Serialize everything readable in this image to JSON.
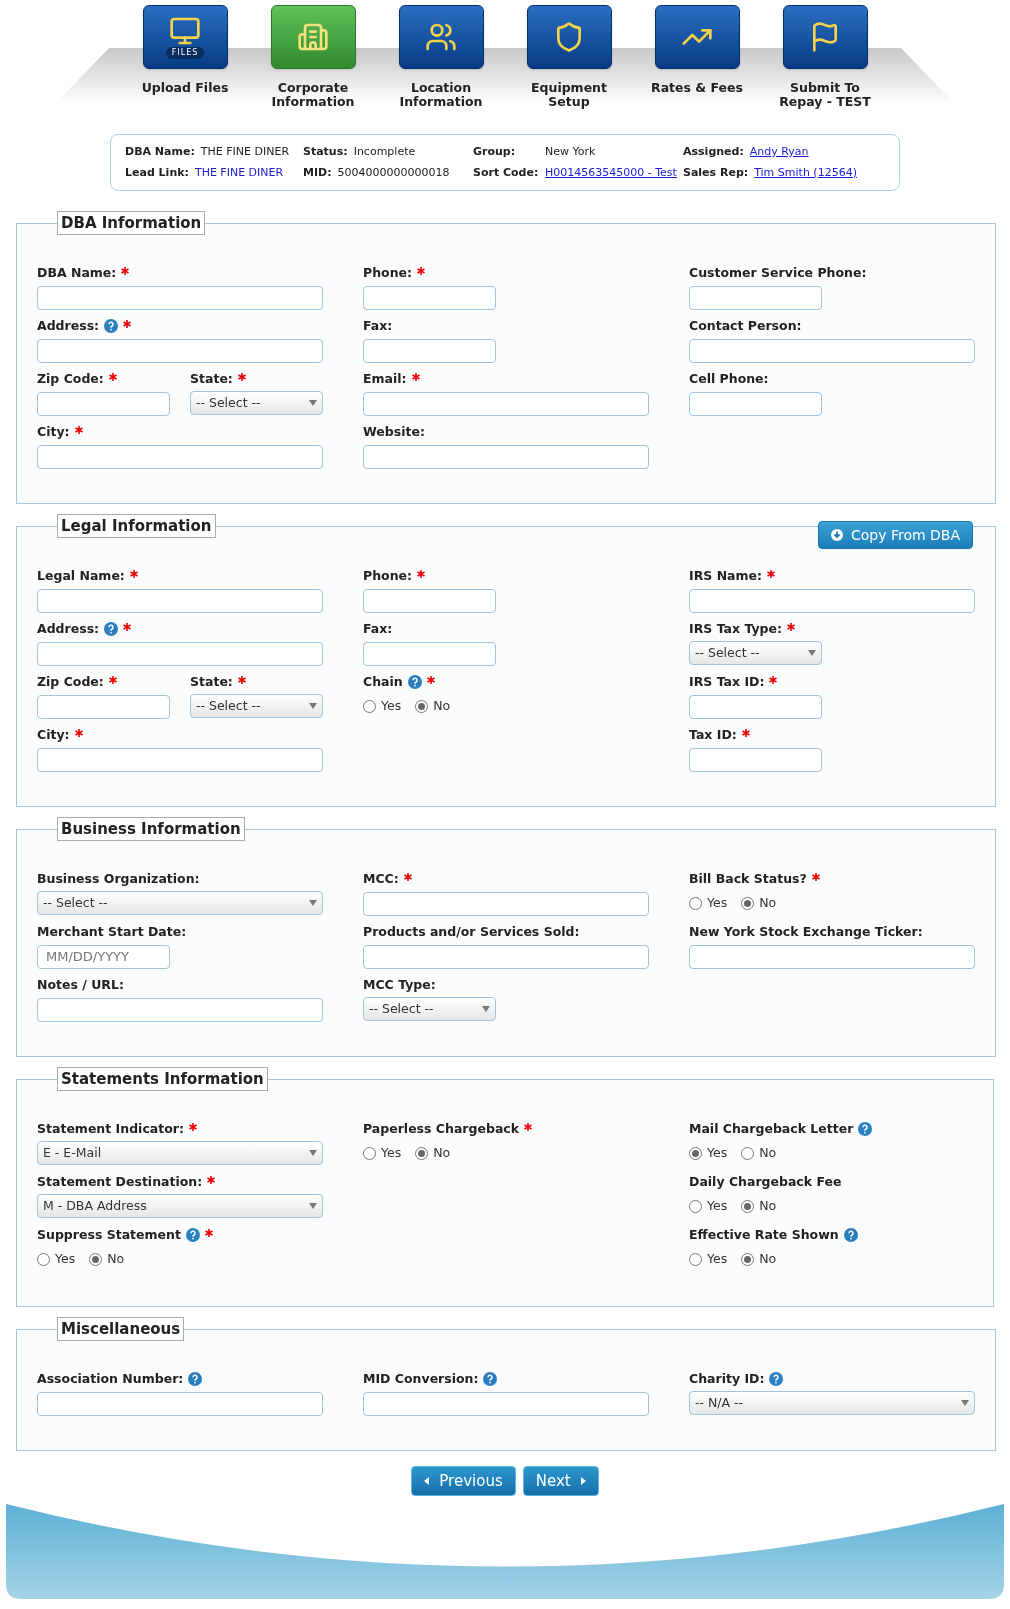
{
  "steps": [
    {
      "label": "Upload Files",
      "selected": false
    },
    {
      "label": "Corporate Information",
      "selected": true
    },
    {
      "label": "Location Information",
      "selected": false
    },
    {
      "label": "Equipment Setup",
      "selected": false
    },
    {
      "label": "Rates & Fees",
      "selected": false
    },
    {
      "label": "Submit To Repay - TEST",
      "selected": false
    }
  ],
  "step_badge": "FILES",
  "summary": {
    "rows": [
      [
        {
          "label": "DBA Name:",
          "value": "THE FINE DINER",
          "kind": "plain"
        },
        {
          "label": "Status:",
          "value": "Incomplete",
          "kind": "plain"
        },
        {
          "label": "Group:",
          "value": "New York",
          "kind": "plain"
        },
        {
          "label": "Assigned:",
          "value": "Andy Ryan",
          "kind": "link"
        }
      ],
      [
        {
          "label": "Lead Link:",
          "value": "THE FINE DINER",
          "kind": "lead"
        },
        {
          "label": "MID:",
          "value": "5004000000000018",
          "kind": "plain"
        },
        {
          "label": "Sort Code:",
          "value": "H0014563545000 - Test",
          "kind": "link"
        },
        {
          "label": "Sales Rep:",
          "value": "Tim Smith (12564)",
          "kind": "link"
        }
      ]
    ]
  },
  "sections": [
    {
      "title": "DBA Information",
      "columns": [
        [
          {
            "kind": "input",
            "label": "DBA Name:",
            "required": true,
            "help": false,
            "wide": true
          },
          {
            "kind": "input",
            "label": "Address:",
            "required": true,
            "help": true,
            "wide": true
          },
          {
            "kind": "pair",
            "fields": [
              {
                "kind": "input",
                "label": "Zip Code:",
                "required": true,
                "help": false,
                "wide": false
              },
              {
                "kind": "select",
                "label": "State:",
                "required": true,
                "help": false,
                "wide": false,
                "value": "-- Select --"
              }
            ]
          },
          {
            "kind": "input",
            "label": "City:",
            "required": true,
            "help": false,
            "wide": true
          }
        ],
        [
          {
            "kind": "input",
            "label": "Phone:",
            "required": true,
            "help": false,
            "wide": false
          },
          {
            "kind": "input",
            "label": "Fax:",
            "required": false,
            "help": false,
            "wide": false
          },
          {
            "kind": "input",
            "label": "Email:",
            "required": true,
            "help": false,
            "wide": true
          },
          {
            "kind": "input",
            "label": "Website:",
            "required": false,
            "help": false,
            "wide": true
          }
        ],
        [
          {
            "kind": "input",
            "label": "Customer Service Phone:",
            "required": false,
            "help": false,
            "wide": false
          },
          {
            "kind": "input",
            "label": "Contact Person:",
            "required": false,
            "help": false,
            "wide": true
          },
          {
            "kind": "input",
            "label": "Cell Phone:",
            "required": false,
            "help": false,
            "wide": false
          }
        ]
      ]
    },
    {
      "title": "Legal Information",
      "action": "Copy From DBA",
      "columns": [
        [
          {
            "kind": "input",
            "label": "Legal Name:",
            "required": true,
            "help": false,
            "wide": true
          },
          {
            "kind": "input",
            "label": "Address:",
            "required": true,
            "help": true,
            "wide": true
          },
          {
            "kind": "pair",
            "fields": [
              {
                "kind": "input",
                "label": "Zip Code:",
                "required": true,
                "help": false,
                "wide": false
              },
              {
                "kind": "select",
                "label": "State:",
                "required": true,
                "help": false,
                "wide": false,
                "value": "-- Select --"
              }
            ]
          },
          {
            "kind": "input",
            "label": "City:",
            "required": true,
            "help": false,
            "wide": true
          }
        ],
        [
          {
            "kind": "input",
            "label": "Phone:",
            "required": true,
            "help": false,
            "wide": false
          },
          {
            "kind": "input",
            "label": "Fax:",
            "required": false,
            "help": false,
            "wide": false
          },
          {
            "kind": "radio",
            "label": "Chain",
            "required": true,
            "help": true,
            "options": [
              {
                "label": "Yes",
                "selected": false
              },
              {
                "label": "No",
                "selected": true
              }
            ]
          }
        ],
        [
          {
            "kind": "input",
            "label": "IRS Name:",
            "required": true,
            "help": false,
            "wide": true
          },
          {
            "kind": "select",
            "label": "IRS Tax Type:",
            "required": true,
            "help": false,
            "wide": false,
            "value": "-- Select --"
          },
          {
            "kind": "input",
            "label": "IRS Tax ID:",
            "required": true,
            "help": false,
            "wide": false
          },
          {
            "kind": "input",
            "label": "Tax ID:",
            "required": true,
            "help": false,
            "wide": false
          }
        ]
      ]
    },
    {
      "title": "Business Information",
      "columns": [
        [
          {
            "kind": "select",
            "label": "Business Organization:",
            "required": false,
            "help": false,
            "wide": true,
            "value": "-- Select --"
          },
          {
            "kind": "input",
            "label": "Merchant Start Date:",
            "required": false,
            "help": false,
            "wide": false,
            "placeholder": "MM/DD/YYYY"
          },
          {
            "kind": "input",
            "label": "Notes / URL:",
            "required": false,
            "help": false,
            "wide": true
          }
        ],
        [
          {
            "kind": "input",
            "label": "MCC:",
            "required": true,
            "help": false,
            "wide": true
          },
          {
            "kind": "input",
            "label": "Products and/or Services Sold:",
            "required": false,
            "help": false,
            "wide": true
          },
          {
            "kind": "select",
            "label": "MCC Type:",
            "required": false,
            "help": false,
            "wide": false,
            "value": "-- Select --"
          }
        ],
        [
          {
            "kind": "radio",
            "label": "Bill Back Status?",
            "required": true,
            "help": false,
            "options": [
              {
                "label": "Yes",
                "selected": false
              },
              {
                "label": "No",
                "selected": true
              }
            ]
          },
          {
            "kind": "input",
            "label": "New York Stock Exchange Ticker:",
            "required": false,
            "help": false,
            "wide": true
          }
        ]
      ]
    },
    {
      "title": "Statements Information",
      "columns": [
        [
          {
            "kind": "select",
            "label": "Statement Indicator:",
            "required": true,
            "help": false,
            "wide": true,
            "value": "E - E-Mail"
          },
          {
            "kind": "select",
            "label": "Statement Destination:",
            "required": true,
            "help": false,
            "wide": true,
            "value": "M - DBA Address"
          },
          {
            "kind": "radio",
            "label": "Suppress Statement",
            "required": true,
            "help": true,
            "options": [
              {
                "label": "Yes",
                "selected": false
              },
              {
                "label": "No",
                "selected": true
              }
            ]
          }
        ],
        [
          {
            "kind": "radio",
            "label": "Paperless Chargeback",
            "required": true,
            "help": false,
            "options": [
              {
                "label": "Yes",
                "selected": false
              },
              {
                "label": "No",
                "selected": true
              }
            ]
          }
        ],
        [
          {
            "kind": "radio",
            "label": "Mail Chargeback Letter",
            "required": false,
            "help": true,
            "options": [
              {
                "label": "Yes",
                "selected": true
              },
              {
                "label": "No",
                "selected": false
              }
            ]
          },
          {
            "kind": "radio",
            "label": "Daily Chargeback Fee",
            "required": false,
            "help": false,
            "options": [
              {
                "label": "Yes",
                "selected": false
              },
              {
                "label": "No",
                "selected": true
              }
            ]
          },
          {
            "kind": "radio",
            "label": "Effective Rate Shown",
            "required": false,
            "help": true,
            "options": [
              {
                "label": "Yes",
                "selected": false
              },
              {
                "label": "No",
                "selected": true
              }
            ]
          }
        ]
      ]
    },
    {
      "title": "Miscellaneous",
      "columns": [
        [
          {
            "kind": "input",
            "label": "Association Number:",
            "required": false,
            "help": true,
            "wide": true
          }
        ],
        [
          {
            "kind": "input",
            "label": "MID Conversion:",
            "required": false,
            "help": true,
            "wide": true
          }
        ],
        [
          {
            "kind": "select",
            "label": "Charity ID:",
            "required": false,
            "help": true,
            "wide": true,
            "value": "-- N/A --"
          }
        ]
      ]
    }
  ],
  "nav": {
    "previous": "Previous",
    "next": "Next"
  }
}
